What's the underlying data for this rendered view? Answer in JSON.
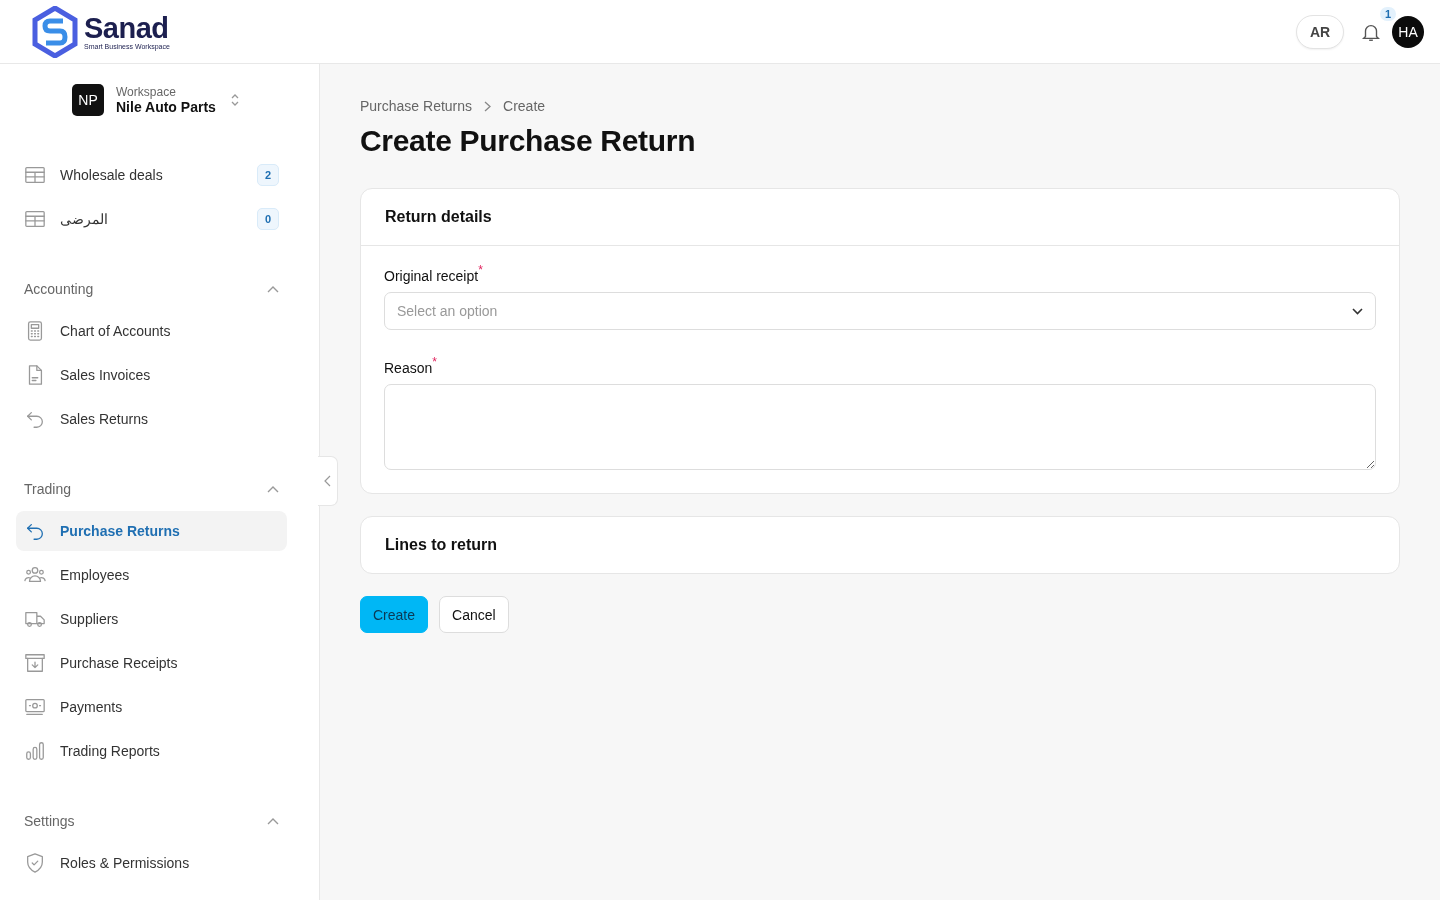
{
  "brand": {
    "name": "Sanad",
    "tagline": "Smart Business Workspace"
  },
  "header": {
    "language": "AR",
    "notifications": "1",
    "avatar": "HA"
  },
  "workspace": {
    "initials": "NP",
    "label": "Workspace",
    "name": "Nile Auto Parts"
  },
  "nav_groups": [
    {
      "items": [
        {
          "label": "Wholesale deals",
          "badge": "2",
          "selected": false
        },
        {
          "label": "المرضى",
          "badge": "0",
          "selected": false
        }
      ]
    },
    {
      "title": "Accounting",
      "expanded": true,
      "items": [
        {
          "label": "Chart of Accounts",
          "selected": false
        },
        {
          "label": "Sales Invoices",
          "selected": false
        },
        {
          "label": "Sales Returns",
          "selected": false
        }
      ]
    },
    {
      "title": "Trading",
      "expanded": true,
      "items": [
        {
          "label": "Purchase Returns",
          "selected": true
        },
        {
          "label": "Employees",
          "selected": false
        },
        {
          "label": "Suppliers",
          "selected": false
        },
        {
          "label": "Purchase Receipts",
          "selected": false
        },
        {
          "label": "Payments",
          "selected": false
        },
        {
          "label": "Trading Reports",
          "selected": false
        }
      ]
    },
    {
      "title": "Settings",
      "expanded": true,
      "items": [
        {
          "label": "Roles & Permissions",
          "selected": false
        }
      ]
    }
  ],
  "breadcrumb": [
    "Purchase Returns",
    "Create"
  ],
  "title": "Create Purchase Return",
  "return_details": {
    "title": "Return details",
    "fields": [
      {
        "kind": "select",
        "label": "Original receipt",
        "required_mark": "*",
        "placeholder": "Select an option"
      },
      {
        "kind": "textarea",
        "label": "Reason",
        "required_mark": "*"
      }
    ]
  },
  "lines_section": {
    "title": "Lines to return"
  },
  "buttons": [
    {
      "label": "Create",
      "kind": "primary"
    },
    {
      "label": "Cancel",
      "kind": "secondary"
    }
  ]
}
